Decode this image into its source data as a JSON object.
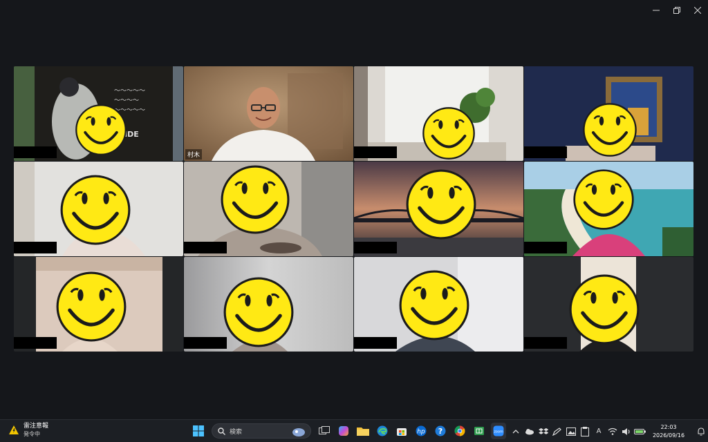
{
  "window": {
    "controls": [
      "minimize",
      "restore",
      "close"
    ]
  },
  "gallery": {
    "active_participant_label": "村木",
    "tiles": [
      {
        "bg": "#5a5f58",
        "icon": "baseball-poster-background"
      },
      {
        "bg": "#a07d5e",
        "icon": "host-video",
        "label": "村木"
      },
      {
        "bg": "#d9d5cf",
        "icon": "room-with-plant-background"
      },
      {
        "bg": "#232b4a",
        "icon": "painting-background"
      },
      {
        "bg": "#dedcd9",
        "icon": "plain-wall-background"
      },
      {
        "bg": "#b9b3ac",
        "icon": "room-background"
      },
      {
        "bg": "#6a4f4c",
        "icon": "sunset-bridge-background"
      },
      {
        "bg": "#4e8a92",
        "icon": "beach-background"
      },
      {
        "bg": "#d9c8bb",
        "icon": "room-background"
      },
      {
        "bg": "#c9c9c9",
        "icon": "blurred-background"
      },
      {
        "bg": "#d6d6d8",
        "icon": "blurred-background"
      },
      {
        "bg": "#2a2c2f",
        "icon": "dark-background"
      }
    ]
  },
  "taskbar": {
    "weather_title": "雷注意報",
    "weather_sub": "発令中",
    "search_placeholder": "検索",
    "clock_time": "22:03",
    "clock_date": "2026/09/16",
    "ime_label": "A"
  }
}
